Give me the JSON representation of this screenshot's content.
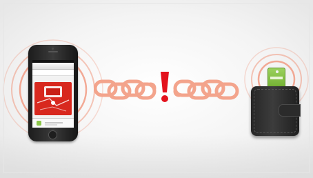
{
  "scene": {
    "colors": {
      "signal_ring": "#f08f74",
      "chain": "#f3a48c",
      "alert": "#e3121d",
      "phone_body": "#1f1f1f",
      "wallet_body": "#2d2d2d",
      "tag": "#8cc64a",
      "background": "#f2f2f2"
    },
    "phone": {
      "screen_icons": [
        "map-icon",
        "location-pin-icon",
        "bell-icon"
      ]
    },
    "connection": {
      "state": "broken",
      "icon": "exclamation-icon"
    },
    "wallet": {
      "item": "tracking-tag",
      "icon": "wallet-icon"
    }
  }
}
